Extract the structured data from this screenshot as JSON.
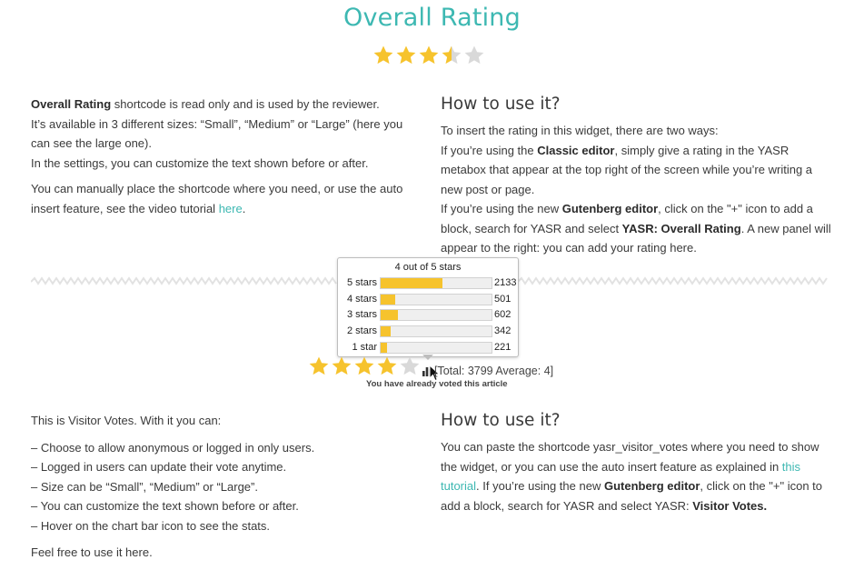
{
  "overall": {
    "title": "Overall Rating",
    "rating": 3.5,
    "max_stars": 5
  },
  "overall_left": {
    "p1_bold": "Overall Rating",
    "p1_rest": " shortcode is read only and is used by the reviewer.",
    "p2": "It’s available in 3 different sizes: “Small”, “Medium” or “Large” (here you can see the large one).",
    "p3": "In the settings, you can customize the text shown before or after.",
    "p4_pre": "You can manually place the shortcode where you need, or use the auto insert feature, see the video tutorial ",
    "p4_link": "here",
    "p4_post": "."
  },
  "overall_right": {
    "heading": "How to use it?",
    "line1": "To insert the rating in this widget, there are two ways:",
    "classic_pre": "If you’re using the ",
    "classic_bold": "Classic editor",
    "classic_post": ", simply give a rating in the YASR metabox that appear at the top right of the screen while you’re writing a new post or page.",
    "gut_pre": "If you’re using the new ",
    "gut_bold": "Gutenberg editor",
    "gut_mid": ", click on the \"+\" icon to add a block, search for YASR and select ",
    "gut_bold2": "YASR: Overall Rating",
    "gut_post": ". A new panel will appear to the right: you can add your rating here."
  },
  "tooltip": {
    "title": "4 out of 5 stars",
    "rows": [
      {
        "label": "5 stars",
        "count": "2133",
        "fraction": 0.561
      },
      {
        "label": "4 stars",
        "count": "501",
        "fraction": 0.132
      },
      {
        "label": "3 stars",
        "count": "602",
        "fraction": 0.158
      },
      {
        "label": "2 stars",
        "count": "342",
        "fraction": 0.09
      },
      {
        "label": "1 star",
        "count": "221",
        "fraction": 0.058
      }
    ]
  },
  "visitor": {
    "rating": 4,
    "max_stars": 5,
    "total_text": "[Total: 3799  Average: 4]",
    "voted_text": "You have already voted this article"
  },
  "visitor_left": {
    "intro": "This is Visitor Votes. With it you can:",
    "items": [
      "– Choose to allow anonymous or logged in only users.",
      "– Logged in users can update their vote anytime.",
      "– Size can be “Small”, “Medium” or “Large”.",
      "– You can customize the text shown before or after.",
      "– Hover on the chart bar icon to see the stats."
    ],
    "outro": "Feel free to use it here."
  },
  "visitor_right": {
    "heading": "How to use it?",
    "p_pre": "You can paste the shortcode yasr_visitor_votes where you need to show the widget, or you can use the auto insert feature as explained in ",
    "p_link": "this tutorial",
    "p_mid": ". If you’re using the new ",
    "p_bold": "Gutenberg editor",
    "p_mid2": ", click on the \"+\" icon to add a block, search for YASR and select YASR: ",
    "p_bold2": "Visitor Votes."
  },
  "colors": {
    "accent": "#3db8b2",
    "star_filled": "#f6c32d",
    "star_empty": "#d9d9d9",
    "bar_fill": "#f6c32d"
  }
}
